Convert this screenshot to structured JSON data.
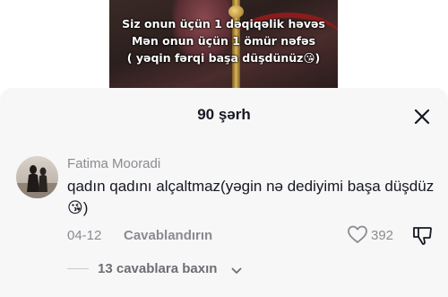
{
  "video": {
    "caption_lines": [
      "Siz onun üçün 1 dəqiqəlik həvəs",
      "Mən onun üçün 1 ömür nəfəs",
      "( yəqin fərqi başa düşdünüz😘)"
    ]
  },
  "comments_sheet": {
    "title": "90 şərh",
    "close_icon": "close-icon"
  },
  "comment": {
    "author": "Fatima Mooradi",
    "text": "qadın qadını alçaltmaz(yəgin nə dediyimi başa düşdüz😘)",
    "date": "04-12",
    "reply_label": "Cavablandırın",
    "like_count": "392",
    "like_icon": "heart-outline-icon",
    "dislike_icon": "thumbs-down-icon",
    "view_replies_label": "13 cavablara baxın",
    "chevron_icon": "chevron-down-icon"
  },
  "colors": {
    "sheet_bg": "#f7f7f7",
    "primary_text": "#161823",
    "secondary_text": "#8a8b91"
  }
}
